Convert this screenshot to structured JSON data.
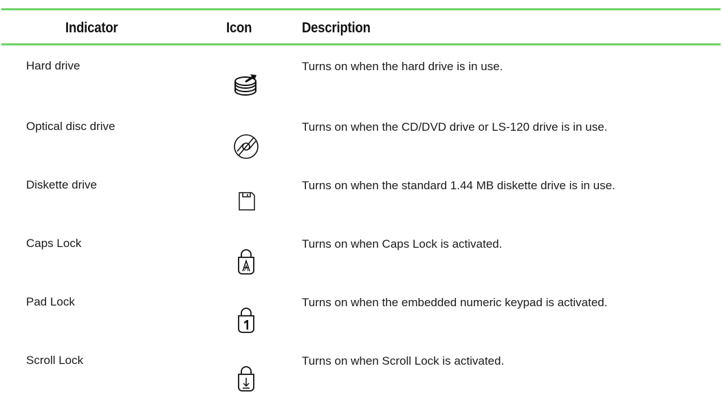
{
  "colors": {
    "rule": "#6ed264",
    "text": "#1a1a1a"
  },
  "table": {
    "headers": {
      "indicator": "Indicator",
      "icon": "Icon",
      "description": "Description"
    },
    "rows": [
      {
        "indicator": "Hard drive",
        "icon": "hard-drive-icon",
        "description": "Turns on when the hard drive is in use."
      },
      {
        "indicator": "Optical disc drive",
        "icon": "optical-disc-icon",
        "description": "Turns on when the CD/DVD drive or LS-120 drive is in use."
      },
      {
        "indicator": "Diskette drive",
        "icon": "diskette-icon",
        "description": "Turns on when the standard 1.44 MB diskette drive is in use."
      },
      {
        "indicator": "Caps Lock",
        "icon": "caps-lock-icon",
        "description": "Turns on when Caps Lock is activated."
      },
      {
        "indicator": "Pad Lock",
        "icon": "pad-lock-icon",
        "description": "Turns on when the embedded numeric keypad is activated."
      },
      {
        "indicator": "Scroll Lock",
        "icon": "scroll-lock-icon",
        "description": "Turns on when Scroll Lock is activated."
      }
    ]
  }
}
